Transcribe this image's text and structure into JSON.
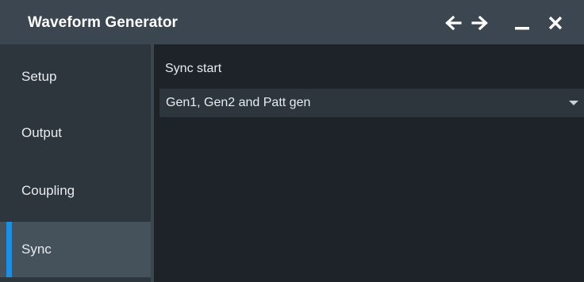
{
  "window": {
    "title": "Waveform Generator",
    "controls": {
      "back_icon": "arrow-left-icon",
      "forward_icon": "arrow-right-icon",
      "minimize_icon": "minimize-icon",
      "close_icon": "close-icon"
    }
  },
  "sidebar": {
    "items": [
      {
        "label": "Setup",
        "active": false
      },
      {
        "label": "Output",
        "active": false
      },
      {
        "label": "Coupling",
        "active": false
      },
      {
        "label": "Sync",
        "active": true
      }
    ]
  },
  "sync": {
    "sync_start_label": "Sync start",
    "sync_start_value": "Gen1, Gen2 and Patt gen"
  },
  "colors": {
    "accent": "#1f8ee0",
    "titlebar_bg": "#3b4650",
    "panel_bg": "#1d2329",
    "sidebar_bg": "#2d353d"
  }
}
